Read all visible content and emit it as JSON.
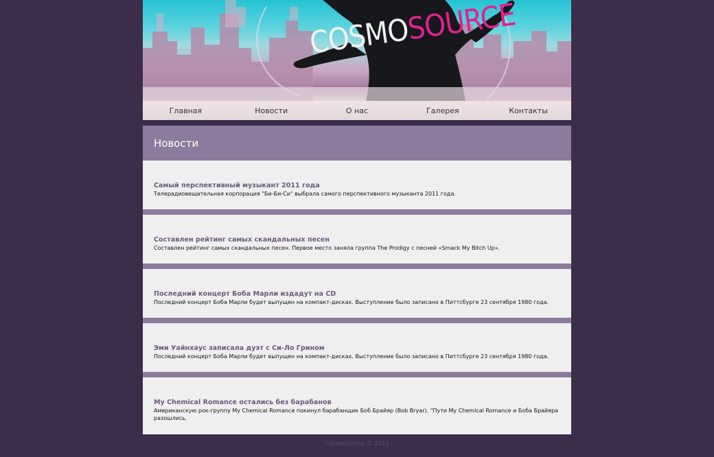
{
  "logo": {
    "part1": "COSMO",
    "part2": "SOURCE"
  },
  "nav": {
    "items": [
      "Главная",
      "Новости",
      "О нас",
      "Галерея",
      "Контакты"
    ]
  },
  "section": {
    "title": "Новости"
  },
  "news": [
    {
      "title": "Самый перспективный музыкант 2011 года",
      "text": "Телерадиовещательная корпорация \"Би-Би-Си\" выбрала самого перспективного музыканта 2011 года."
    },
    {
      "title": "Составлен рейтинг самых скандальных песен",
      "text": "Составлен рейтинг самых скандальных песен. Первое место заняла группа The Prodigy с песней «Smack My Bitch Up»."
    },
    {
      "title": "Последний концерт Боба Марли издадут на CD",
      "text": "Последний концерт Боба Марли будет выпущен на компакт-дисках. Выступление было записано в Питтсбурге 23 сентября 1980 года."
    },
    {
      "title": "Эми Уайнхаус записала дуэт с Си-Ло Грином",
      "text": "Последний концерт Боба Марли будет выпущен на компакт-дисках. Выступление было записано в Питтсбурге 23 сентября 1980 года."
    },
    {
      "title": "My Chemical Romance остались без барабанов",
      "text": "Американскую рок-группу My Chemical Romance покинул барабанщик Боб Брайяр (Bob Bryar). \"Пути My Chemical Romance и Боба Брайяра разошлись."
    }
  ],
  "footer": {
    "text": "CosmoSourse © 2011"
  },
  "colors": {
    "background": "#3c2d4a",
    "accent": "#8c7b9c",
    "news_title": "#6c5a7c",
    "logo_pink": "#e2208c"
  }
}
